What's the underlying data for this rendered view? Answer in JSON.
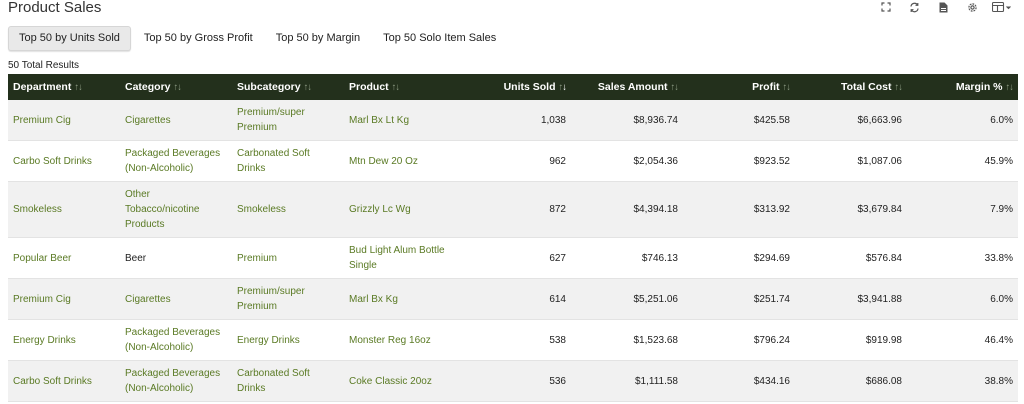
{
  "title": "Product Sales",
  "toolbar_icons": [
    "expand-icon",
    "refresh-icon",
    "export-file-icon",
    "settings-gear-icon",
    "layout-dropdown-icon"
  ],
  "tabs": [
    {
      "label": "Top 50 by Units Sold",
      "active": true
    },
    {
      "label": "Top 50 by Gross Profit",
      "active": false
    },
    {
      "label": "Top 50 by Margin",
      "active": false
    },
    {
      "label": "Top 50 Solo Item Sales",
      "active": false
    }
  ],
  "total_results": "50 Total Results",
  "columns": {
    "department": "Department",
    "category": "Category",
    "subcategory": "Subcategory",
    "product": "Product",
    "units_sold": "Units Sold",
    "sales_amount": "Sales Amount",
    "profit": "Profit",
    "total_cost": "Total Cost",
    "margin": "Margin %"
  },
  "sorted_column": "units_sold",
  "sort_direction": "descending",
  "accent_colors": {
    "header_bg": "#23301c",
    "link_text": "#5a7a24"
  },
  "rows": [
    {
      "department": "Premium Cig",
      "category": "Cigarettes",
      "subcategory": "Premium/super Premium",
      "product": "Marl Bx Lt Kg",
      "units_sold": "1,038",
      "sales_amount": "$8,936.74",
      "profit": "$425.58",
      "total_cost": "$6,663.96",
      "margin": "6.0%"
    },
    {
      "department": "Carbo Soft Drinks",
      "category": "Packaged Beverages (Non-Alcoholic)",
      "subcategory": "Carbonated Soft Drinks",
      "product": "Mtn Dew 20 Oz",
      "units_sold": "962",
      "sales_amount": "$2,054.36",
      "profit": "$923.52",
      "total_cost": "$1,087.06",
      "margin": "45.9%"
    },
    {
      "department": "Smokeless",
      "category": "Other Tobacco/nicotine Products",
      "subcategory": "Smokeless",
      "product": "Grizzly Lc Wg",
      "units_sold": "872",
      "sales_amount": "$4,394.18",
      "profit": "$313.92",
      "total_cost": "$3,679.84",
      "margin": "7.9%"
    },
    {
      "department": "Popular Beer",
      "category": "Beer",
      "subcategory": "Premium",
      "product": "Bud Light Alum Bottle Single",
      "units_sold": "627",
      "sales_amount": "$746.13",
      "profit": "$294.69",
      "total_cost": "$576.84",
      "margin": "33.8%"
    },
    {
      "department": "Premium Cig",
      "category": "Cigarettes",
      "subcategory": "Premium/super Premium",
      "product": "Marl Bx Kg",
      "units_sold": "614",
      "sales_amount": "$5,251.06",
      "profit": "$251.74",
      "total_cost": "$3,941.88",
      "margin": "6.0%"
    },
    {
      "department": "Energy Drinks",
      "category": "Packaged Beverages (Non-Alcoholic)",
      "subcategory": "Energy Drinks",
      "product": "Monster Reg 16oz",
      "units_sold": "538",
      "sales_amount": "$1,523.68",
      "profit": "$796.24",
      "total_cost": "$919.98",
      "margin": "46.4%"
    },
    {
      "department": "Carbo Soft Drinks",
      "category": "Packaged Beverages (Non-Alcoholic)",
      "subcategory": "Carbonated Soft Drinks",
      "product": "Coke Classic 20oz",
      "units_sold": "536",
      "sales_amount": "$1,111.58",
      "profit": "$434.16",
      "total_cost": "$686.08",
      "margin": "38.8%"
    }
  ]
}
